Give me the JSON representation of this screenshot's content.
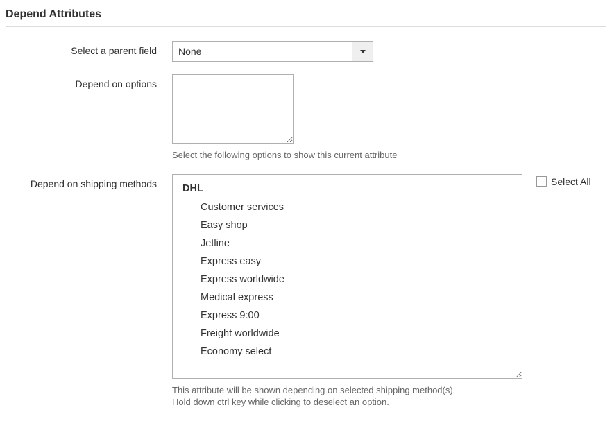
{
  "section_title": "Depend Attributes",
  "fields": {
    "parent": {
      "label": "Select a parent field",
      "value": "None"
    },
    "options": {
      "label": "Depend on options",
      "value": "",
      "helper": "Select the following options to show this current attribute"
    },
    "shipping": {
      "label": "Depend on shipping methods",
      "select_all": "Select All",
      "group": "DHL",
      "items": [
        "Customer services",
        "Easy shop",
        "Jetline",
        "Express easy",
        "Express worldwide",
        "Medical express",
        "Express 9:00",
        "Freight worldwide",
        "Economy select"
      ],
      "helper1": "This attribute will be shown depending on selected shipping method(s).",
      "helper2": "Hold down ctrl key while clicking to deselect an option."
    }
  }
}
